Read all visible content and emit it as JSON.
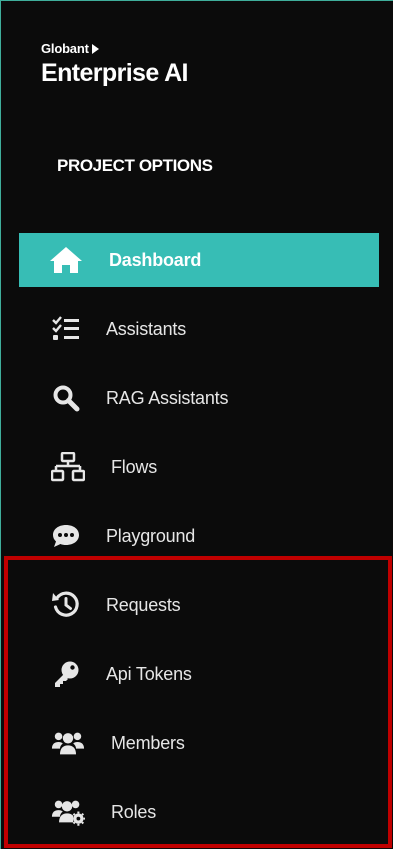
{
  "brand": {
    "company": "Globant",
    "product": "Enterprise AI"
  },
  "section_title": "PROJECT OPTIONS",
  "nav": {
    "active": "Dashboard",
    "items": [
      {
        "label": "Dashboard",
        "icon": "home-icon"
      },
      {
        "label": "Assistants",
        "icon": "checklist-icon"
      },
      {
        "label": "RAG Assistants",
        "icon": "search-icon"
      },
      {
        "label": "Flows",
        "icon": "sitemap-icon"
      },
      {
        "label": "Playground",
        "icon": "chat-bubble-icon"
      },
      {
        "label": "Requests",
        "icon": "history-icon"
      },
      {
        "label": "Api Tokens",
        "icon": "key-icon"
      },
      {
        "label": "Members",
        "icon": "users-icon"
      },
      {
        "label": "Roles",
        "icon": "users-gear-icon"
      }
    ]
  },
  "colors": {
    "background": "#0b0b0b",
    "accent": "#37bdb5",
    "highlight": "#c00000",
    "text": "#e6e6e6"
  }
}
